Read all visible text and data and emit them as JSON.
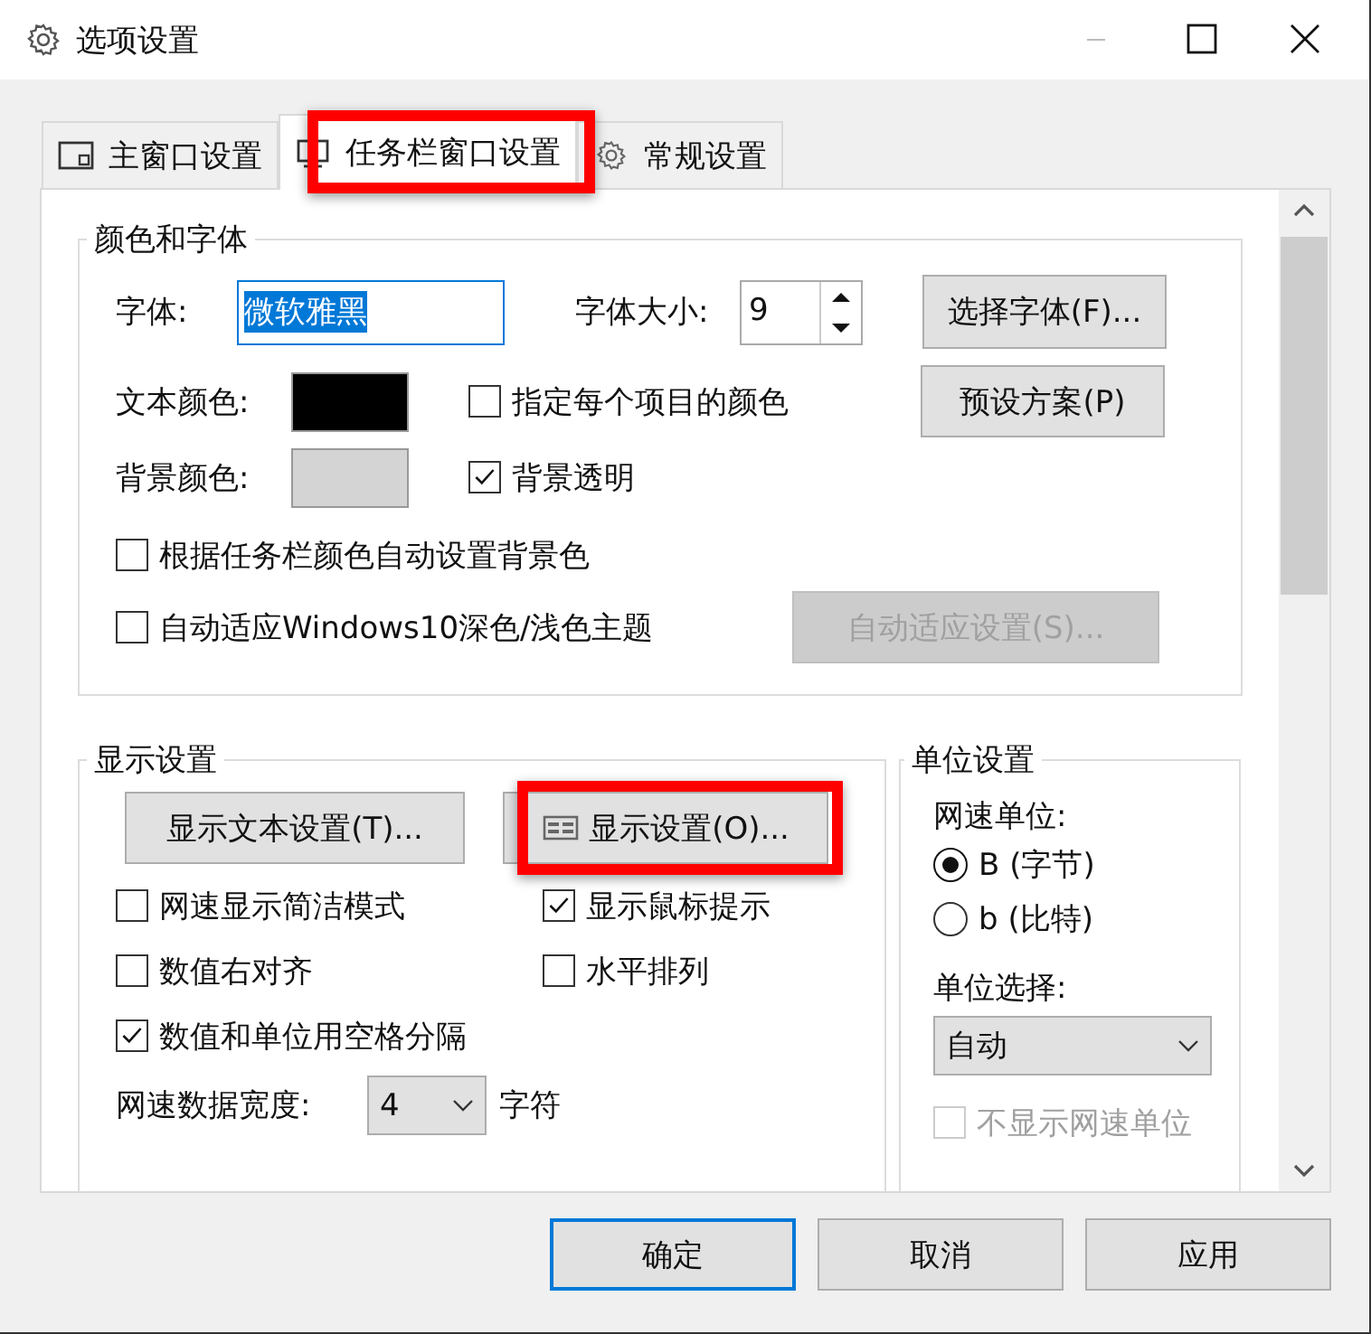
{
  "window": {
    "title": "选项设置"
  },
  "tabs": [
    {
      "label": "主窗口设置",
      "selected": false,
      "highlighted": false
    },
    {
      "label": "任务栏窗口设置",
      "selected": true,
      "highlighted": true
    },
    {
      "label": "常规设置",
      "selected": false,
      "highlighted": false
    }
  ],
  "color_font": {
    "title": "颜色和字体",
    "font_label": "字体:",
    "font_value": "微软雅黑",
    "size_label": "字体大小:",
    "size_value": "9",
    "choose_font_button": "选择字体(F)...",
    "color_rows": [
      {
        "label": "文本颜色:",
        "color": "#000000"
      },
      {
        "label": "背景颜色:",
        "color": "#d4d4d4"
      }
    ],
    "preset_button": "预设方案(P)",
    "checks": [
      {
        "label": "指定每个项目的颜色",
        "checked": false
      },
      {
        "label": "背景透明",
        "checked": true
      },
      {
        "label": "根据任务栏颜色自动设置背景色",
        "checked": false
      },
      {
        "label": "自动适应Windows10深色/浅色主题",
        "checked": false
      }
    ],
    "auto_button": {
      "label": "自动适应设置(S)...",
      "disabled": true
    }
  },
  "display": {
    "title": "显示设置",
    "buttons": [
      {
        "label": "显示文本设置(T)...",
        "icon": false,
        "highlighted": false
      },
      {
        "label": "显示设置(O)...",
        "icon": true,
        "highlighted": true
      }
    ],
    "checks": [
      {
        "label": "网速显示简洁模式",
        "checked": false
      },
      {
        "label": "显示鼠标提示",
        "checked": true
      },
      {
        "label": "数值右对齐",
        "checked": false
      },
      {
        "label": "水平排列",
        "checked": false
      },
      {
        "label": "数值和单位用空格分隔",
        "checked": true
      }
    ],
    "width_label": "网速数据宽度:",
    "width_value": "4",
    "width_unit": "字符"
  },
  "units": {
    "title": "单位设置",
    "speed_unit_label": "网速单位:",
    "radios": [
      {
        "label": "B (字节)",
        "selected": true
      },
      {
        "label": "b (比特)",
        "selected": false
      }
    ],
    "unit_select_label": "单位选择:",
    "unit_select_value": "自动",
    "hide_unit": {
      "label": "不显示网速单位",
      "checked": false,
      "disabled": true
    }
  },
  "buttons": [
    {
      "label": "确定",
      "default": true
    },
    {
      "label": "取消",
      "default": false
    },
    {
      "label": "应用",
      "default": false
    }
  ]
}
